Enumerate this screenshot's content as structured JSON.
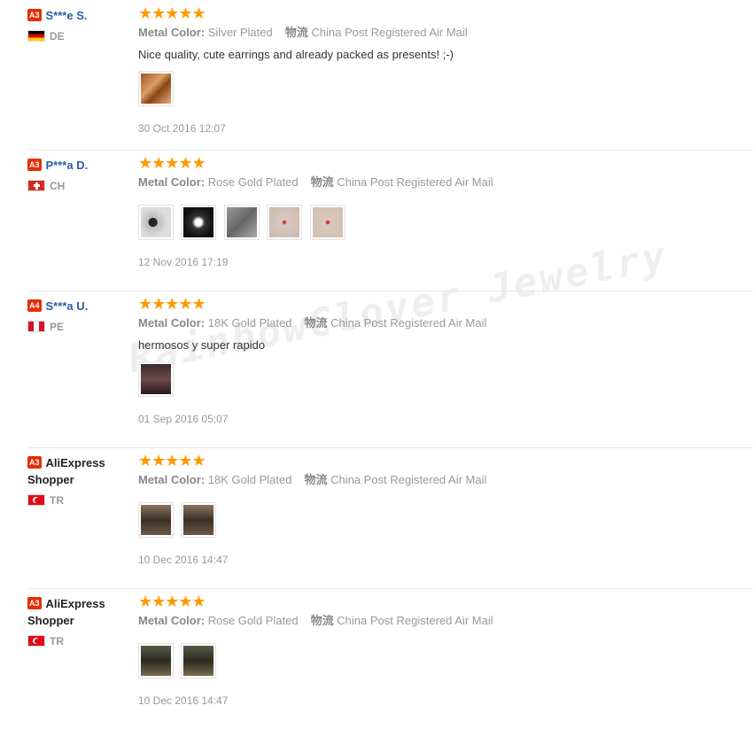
{
  "watermark": "RainbowClover Jewelry",
  "colors": {
    "star": "#ff9900",
    "level_badge": "#e62e04",
    "username": "#2b5ea8"
  },
  "reviews": [
    {
      "level": "A3",
      "username": "S***e S.",
      "country": "DE",
      "flag": "de-flag",
      "stars": "★★★★★",
      "rating": 5,
      "metal_label": "Metal Color:",
      "metal_value": "Silver Plated",
      "logistics_label": "物流",
      "logistics_value": "China Post Registered Air Mail",
      "text": "Nice quality, cute earrings and already packed as presents! ;-)",
      "photo_count": 1,
      "date": "30 Oct 2016 12:07"
    },
    {
      "level": "A3",
      "username": "P***a D.",
      "country": "CH",
      "flag": "ch-flag",
      "stars": "★★★★★",
      "rating": 5,
      "metal_label": "Metal Color:",
      "metal_value": "Rose Gold Plated",
      "logistics_label": "物流",
      "logistics_value": "China Post Registered Air Mail",
      "text": "",
      "photo_count": 5,
      "date": "12 Nov 2016 17:19"
    },
    {
      "level": "A4",
      "username": "S***a U.",
      "country": "PE",
      "flag": "pe-flag",
      "stars": "★★★★★",
      "rating": 5,
      "metal_label": "Metal Color:",
      "metal_value": "18K Gold Plated",
      "logistics_label": "物流",
      "logistics_value": "China Post Registered Air Mail",
      "text": "hermosos y super rapido",
      "photo_count": 1,
      "date": "01 Sep 2016 05:07"
    },
    {
      "level": "A3",
      "username": "AliExpress Shopper",
      "country": "TR",
      "flag": "tr-flag",
      "stars": "★★★★★",
      "rating": 5,
      "metal_label": "Metal Color:",
      "metal_value": "18K Gold Plated",
      "logistics_label": "物流",
      "logistics_value": "China Post Registered Air Mail",
      "text": "",
      "photo_count": 2,
      "date": "10 Dec 2016 14:47"
    },
    {
      "level": "A3",
      "username": "AliExpress Shopper",
      "country": "TR",
      "flag": "tr-flag",
      "stars": "★★★★★",
      "rating": 5,
      "metal_label": "Metal Color:",
      "metal_value": "Rose Gold Plated",
      "logistics_label": "物流",
      "logistics_value": "China Post Registered Air Mail",
      "text": "",
      "photo_count": 2,
      "date": "10 Dec 2016 14:47"
    }
  ]
}
